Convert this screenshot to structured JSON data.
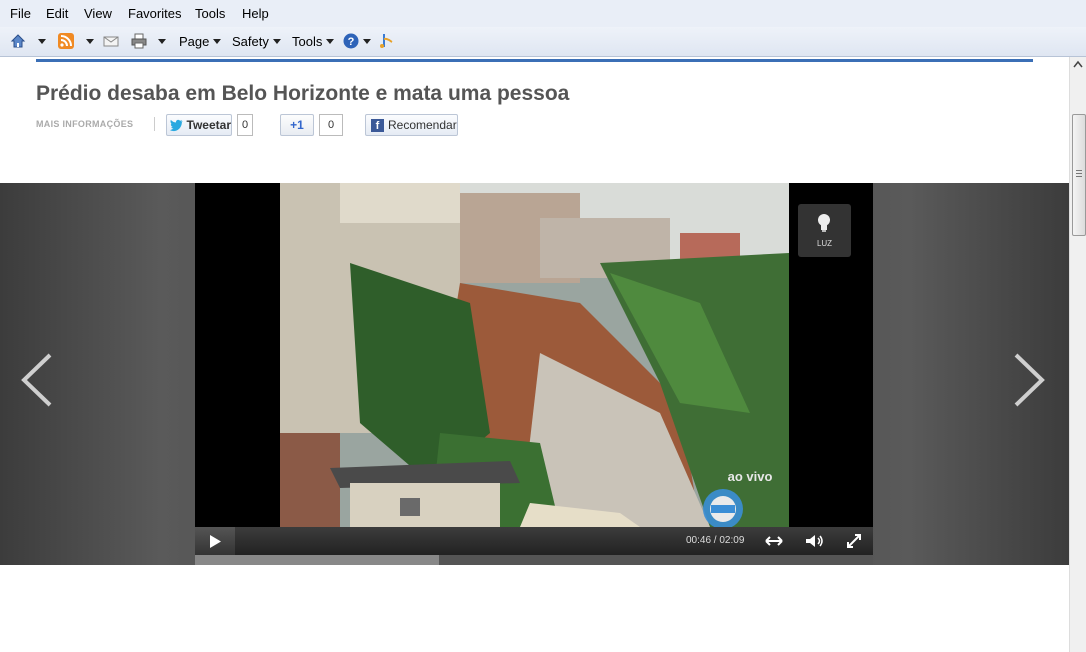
{
  "menu": [
    "File",
    "Edit",
    "View",
    "Favorites",
    "Tools",
    "Help"
  ],
  "toolbar": {
    "page": "Page",
    "safety": "Safety",
    "tools": "Tools"
  },
  "article": {
    "title": "Prédio desaba em Belo Horizonte e mata uma pessoa",
    "more_info": "MAIS INFORMAÇÕES",
    "tweet_label": "Tweetar",
    "tweet_count": "0",
    "plusone_label": "+1",
    "plusone_count": "0",
    "fb_label": "Recomendar"
  },
  "player": {
    "luz_label": "LUZ",
    "time": "00:46 / 02:09",
    "progress": 0.36,
    "watermark": "ao vivo"
  },
  "colors": {
    "accent": "#3b6fb6",
    "title": "#555555",
    "facebook": "#3b5998",
    "twitter": "#1da1f2"
  }
}
